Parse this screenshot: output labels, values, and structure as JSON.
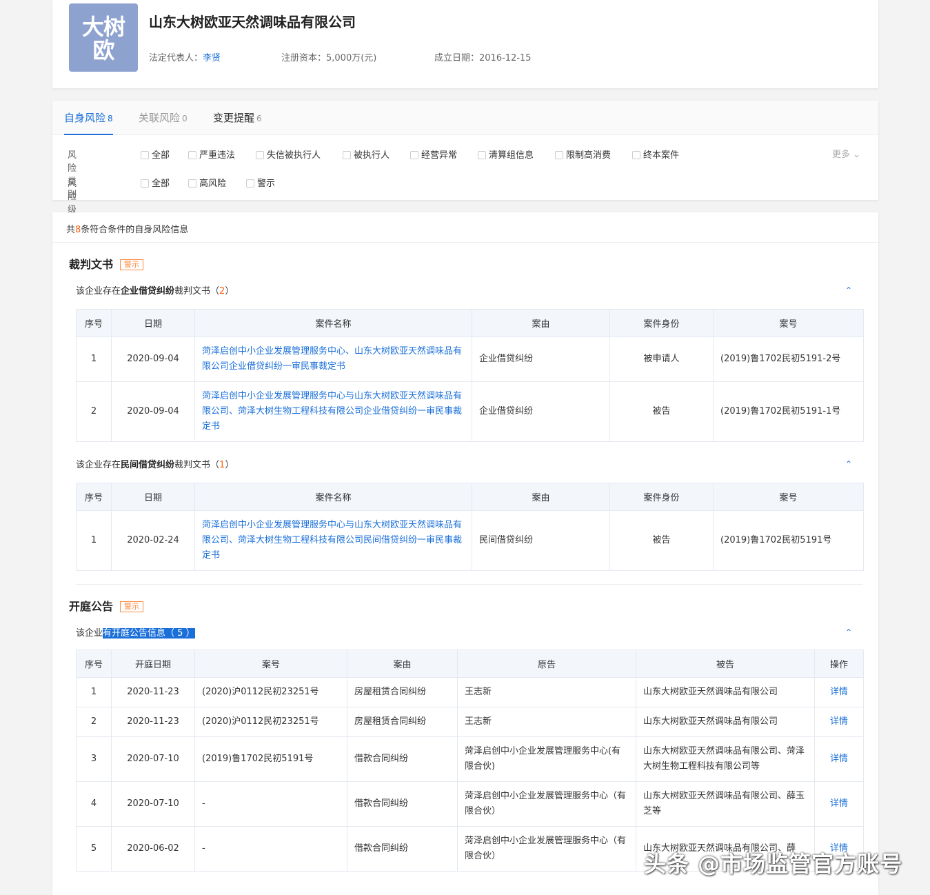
{
  "company": {
    "logo_text_line1": "大树",
    "logo_text_line2": "欧",
    "name": "山东大树欧亚天然调味品有限公司",
    "legal_rep_label": "法定代表人：",
    "legal_rep": "李贤",
    "capital": "注册资本：5,000万(元)",
    "founded": "成立日期：2016-12-15"
  },
  "tabs": [
    {
      "label": "自身风险",
      "count": "8"
    },
    {
      "label": "关联风险",
      "count": "0"
    },
    {
      "label": "变更提醒",
      "count": "6"
    }
  ],
  "filters": {
    "category_label": "风险类别",
    "category_options": [
      "全部",
      "严重违法",
      "失信被执行人",
      "被执行人",
      "经营异常",
      "清算组信息",
      "限制高消费",
      "终本案件"
    ],
    "more": "更多 ⌄",
    "level_label": "风险级别",
    "level_options": [
      "全部",
      "高风险",
      "警示"
    ]
  },
  "summary": {
    "prefix": "共",
    "count": "8",
    "suffix": "条符合条件的自身风险信息"
  },
  "judgments": {
    "title": "裁判文书",
    "tag": "警示",
    "groups": [
      {
        "pre": "该企业存在",
        "bold": "企业借贷纠纷",
        "post": "裁判文书（",
        "count": "2",
        "close": "）",
        "headers": [
          "序号",
          "日期",
          "案件名称",
          "案由",
          "案件身份",
          "案号"
        ],
        "rows": [
          [
            "1",
            "2020-09-04",
            "菏泽启创中小企业发展管理服务中心、山东大树欧亚天然调味品有限公司企业借贷纠纷一审民事裁定书",
            "企业借贷纠纷",
            "被申请人",
            "(2019)鲁1702民初5191-2号"
          ],
          [
            "2",
            "2020-09-04",
            "菏泽启创中小企业发展管理服务中心与山东大树欧亚天然调味品有限公司、菏泽大树生物工程科技有限公司企业借贷纠纷一审民事裁定书",
            "企业借贷纠纷",
            "被告",
            "(2019)鲁1702民初5191-1号"
          ]
        ]
      },
      {
        "pre": "该企业存在",
        "bold": "民间借贷纠纷",
        "post": "裁判文书（",
        "count": "1",
        "close": "）",
        "headers": [
          "序号",
          "日期",
          "案件名称",
          "案由",
          "案件身份",
          "案号"
        ],
        "rows": [
          [
            "1",
            "2020-02-24",
            "菏泽启创中小企业发展管理服务中心与山东大树欧亚天然调味品有限公司、菏泽大树生物工程科技有限公司民间借贷纠纷一审民事裁定书",
            "民间借贷纠纷",
            "被告",
            "(2019)鲁1702民初5191号"
          ]
        ]
      }
    ]
  },
  "hearings": {
    "title": "开庭公告",
    "tag": "警示",
    "sub_pre": "该企业",
    "sub_hl": "有开庭公告信息（ 5 ）",
    "headers": [
      "序号",
      "开庭日期",
      "案号",
      "案由",
      "原告",
      "被告",
      "操作"
    ],
    "rows": [
      [
        "1",
        "2020-11-23",
        "(2020)沪0112民初23251号",
        "房屋租赁合同纠纷",
        "王志新",
        "山东大树欧亚天然调味品有限公司",
        "详情"
      ],
      [
        "2",
        "2020-11-23",
        "(2020)沪0112民初23251号",
        "房屋租赁合同纠纷",
        "王志新",
        "山东大树欧亚天然调味品有限公司",
        "详情"
      ],
      [
        "3",
        "2020-07-10",
        "(2019)鲁1702民初5191号",
        "借款合同纠纷",
        "菏泽启创中小企业发展管理服务中心(有限合伙)",
        "山东大树欧亚天然调味品有限公司、菏泽大树生物工程科技有限公司等",
        "详情"
      ],
      [
        "4",
        "2020-07-10",
        "-",
        "借款合同纠纷",
        "菏泽启创中小企业发展管理服务中心（有限合伙）",
        "山东大树欧亚天然调味品有限公司、薛玉芝等",
        "详情"
      ],
      [
        "5",
        "2020-06-02",
        "-",
        "借款合同纠纷",
        "菏泽启创中小企业发展管理服务中心（有限合伙）",
        "山东大树欧亚天然调味品有限公司、薛",
        "详情"
      ]
    ]
  },
  "watermark": "头条 @市场监管官方账号",
  "colors": {
    "accent": "#1a6fd9",
    "warn": "#ff8a3d",
    "logo_bg": "#8da2cf"
  }
}
